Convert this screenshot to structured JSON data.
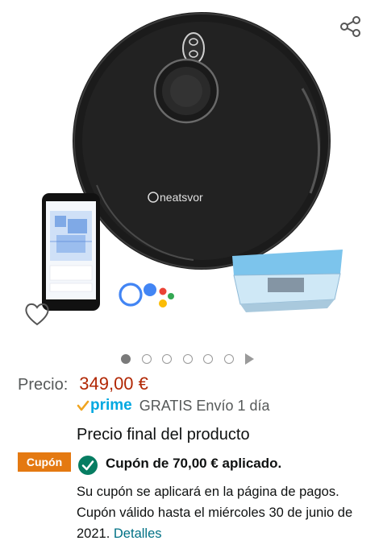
{
  "gallery": {
    "brand_mark": "neatsvor",
    "icons": {
      "share": "share-icon",
      "wishlist": "heart-outline-icon",
      "play": "play-triangle-icon"
    },
    "image_count": 6,
    "active_index": 0
  },
  "price": {
    "label": "Precio:",
    "value": "349,00 €"
  },
  "prime": {
    "logo_text": "prime",
    "shipping": "GRATIS Envío 1 día"
  },
  "final_price_note": "Precio final del producto",
  "coupon": {
    "badge": "Cupón",
    "applied": "Cupón de 70,00 € aplicado.",
    "info_text": "Su cupón se aplicará en la página de pagos. Cupón válido hasta el miércoles 30 de junio de 2021.",
    "details_link": "Detalles"
  },
  "colors": {
    "price": "#b12704",
    "prime": "#00a8e1",
    "coupon_badge": "#e47911",
    "check": "#067d62",
    "link": "#007185"
  }
}
